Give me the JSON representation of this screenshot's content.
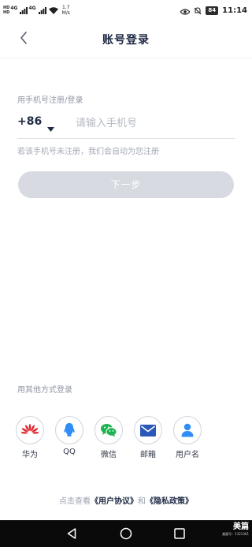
{
  "status_bar": {
    "network_type_1": "4G",
    "network_type_2": "4G",
    "hd_1": "HD",
    "hd_2": "HD",
    "speed_value": "1.7",
    "speed_unit": "M/s",
    "battery": "84",
    "time": "11:14"
  },
  "header": {
    "title": "账号登录",
    "back_icon": "chevron-left-icon"
  },
  "phone_login": {
    "section_label": "用手机号注册/登录",
    "country_code": "+86",
    "phone_placeholder": "请输入手机号",
    "phone_value": "",
    "hint": "若该手机号未注册，我们会自动为您注册",
    "next_button": "下一步"
  },
  "other_login": {
    "label": "用其他方式登录",
    "methods": [
      {
        "label": "华为",
        "icon": "huawei-icon",
        "color": "#e3262d"
      },
      {
        "label": "QQ",
        "icon": "qq-icon",
        "color": "#2f8df5"
      },
      {
        "label": "微信",
        "icon": "wechat-icon",
        "color": "#1db34f"
      },
      {
        "label": "邮箱",
        "icon": "mail-icon",
        "color": "#2a58b8"
      },
      {
        "label": "用户名",
        "icon": "user-icon",
        "color": "#2f8df5"
      }
    ]
  },
  "agreement": {
    "prefix": "点击查看",
    "user_agreement": "《用户协议》",
    "conjunction": "和",
    "privacy_policy": "《隐私政策》"
  },
  "watermark": {
    "brand": "美篇",
    "sub_line_1": "美篇号：1321361"
  },
  "colors": {
    "primary_text": "#1f2a44",
    "button_disabled": "#d7dbe1",
    "system_nav": "#0a0a0a"
  }
}
